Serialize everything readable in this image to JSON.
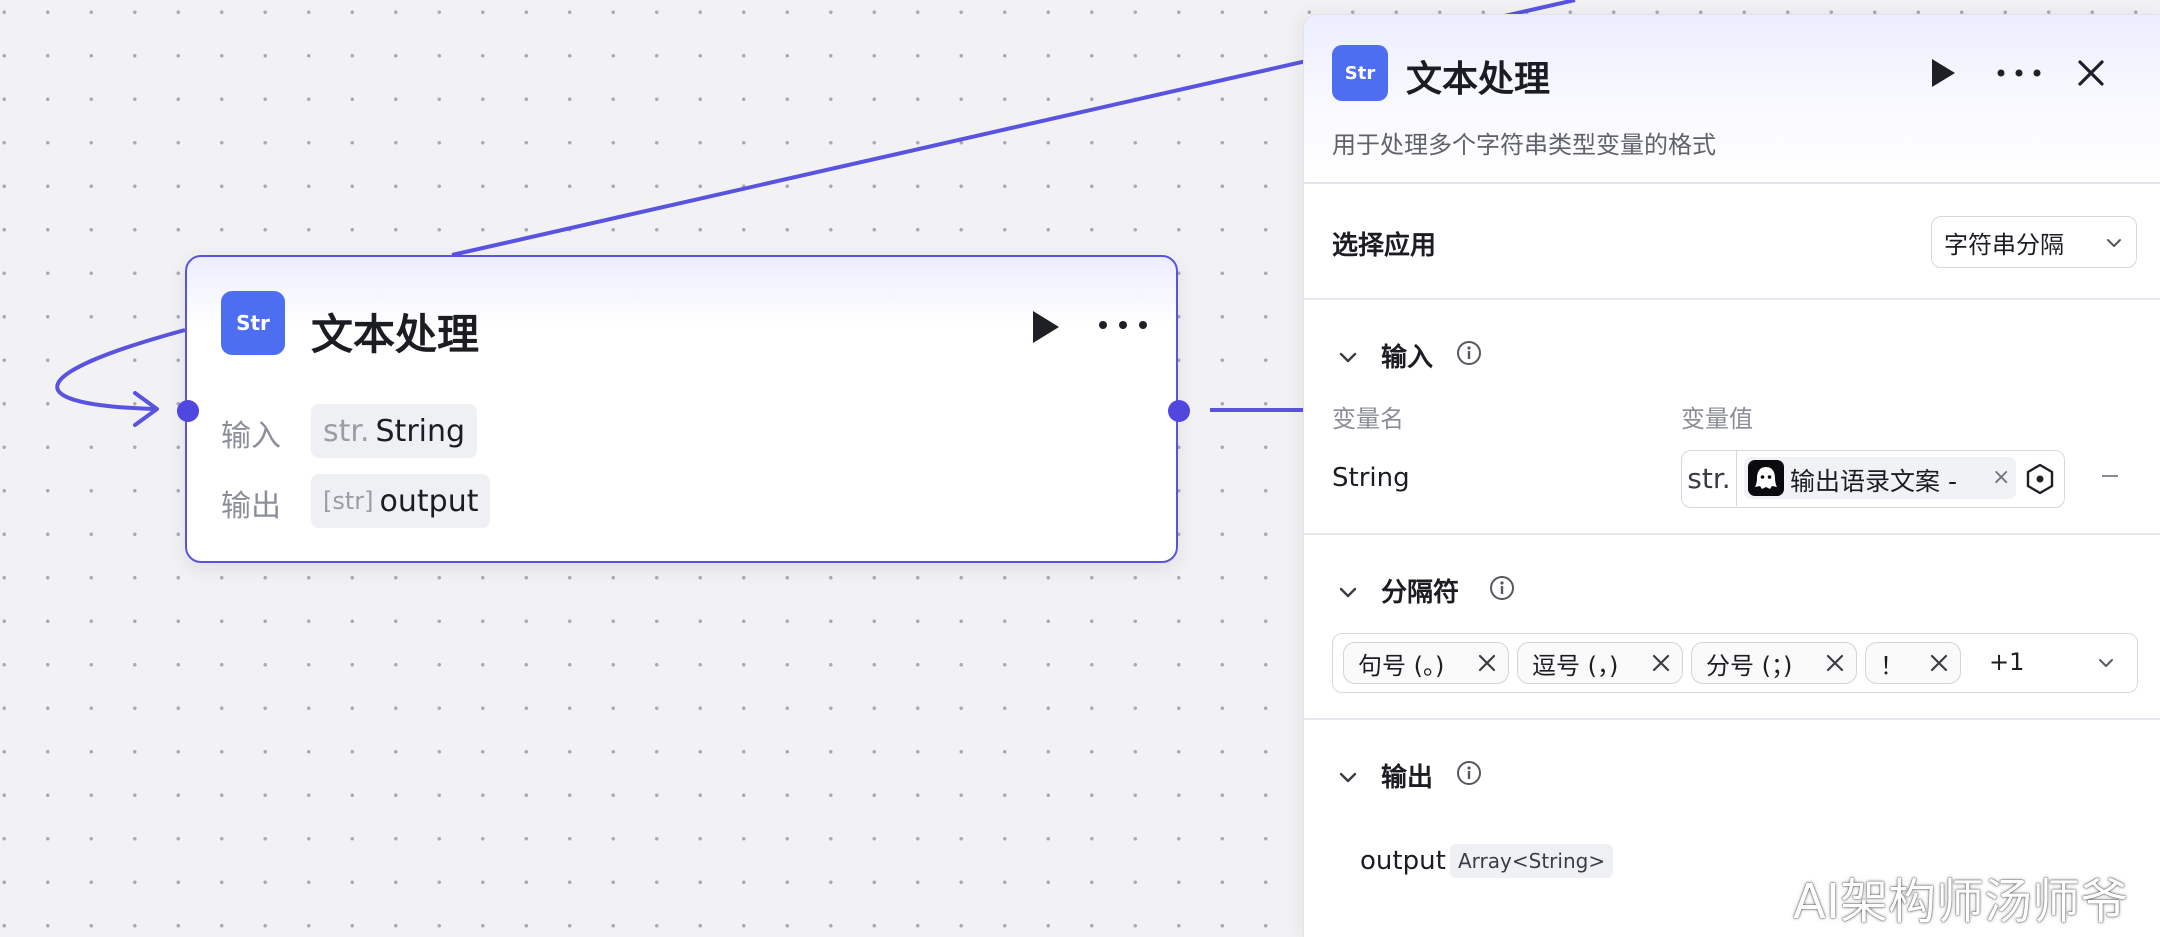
{
  "node": {
    "title": "文本处理",
    "icon": "Str",
    "input_label": "输入",
    "input_type_prefix": "str.",
    "input_value": "String",
    "output_label": "输出",
    "output_type_prefix": "[str]",
    "output_value": "output"
  },
  "panel": {
    "icon": "Str",
    "title": "文本处理",
    "description": "用于处理多个字符串类型变量的格式",
    "app_label": "选择应用",
    "app_value": "字符串分隔",
    "input_section": "输入",
    "col_var_name": "变量名",
    "col_var_value": "变量值",
    "var_name": "String",
    "var_prefix": "str.",
    "var_ref_text": "输出语录文案 - ",
    "var_ref_close": "×",
    "separator_section": "分隔符",
    "separators": [
      "句号 (。)",
      "逗号 (，)",
      "分号 (；)",
      "！"
    ],
    "separators_more": "+1",
    "output_section": "输出",
    "output_name": "output",
    "output_type": "Array<String>"
  },
  "watermark": "AI架构师汤师爷",
  "colors": {
    "accent": "#4f47e0",
    "brand": "#4e6ef2",
    "canvas": "#f2f2f4"
  }
}
